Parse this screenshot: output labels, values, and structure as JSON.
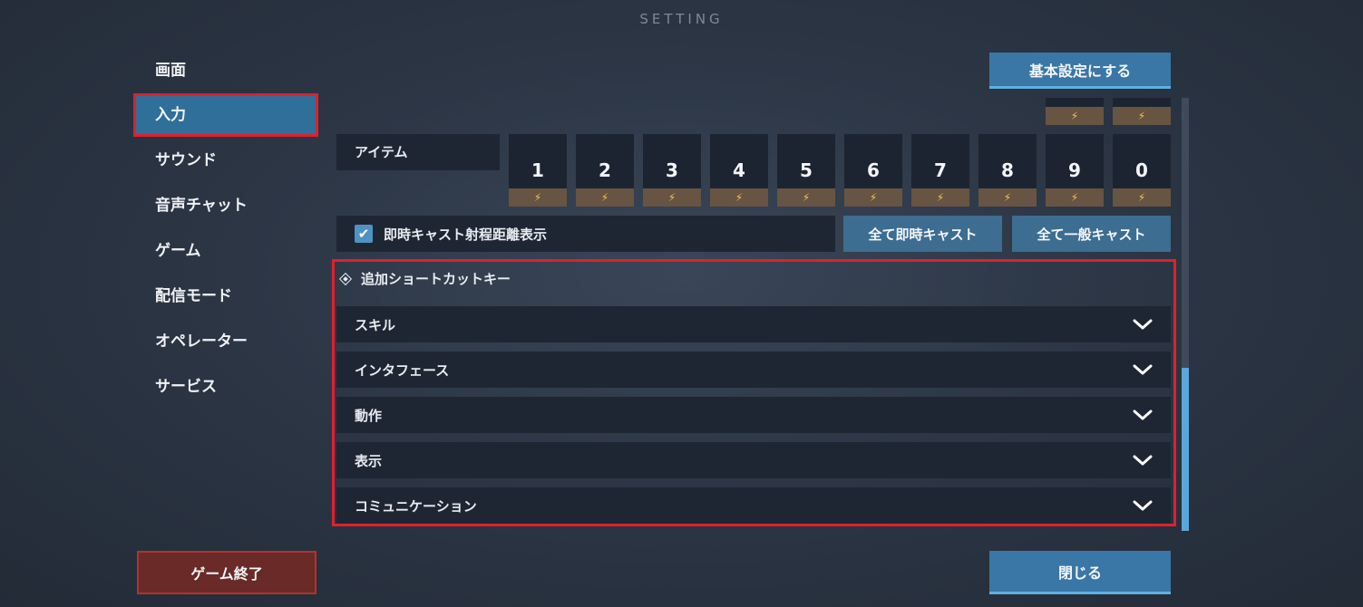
{
  "header": {
    "title": "SETTING"
  },
  "sidebar": {
    "items": [
      {
        "label": "画面"
      },
      {
        "label": "入力"
      },
      {
        "label": "サウンド"
      },
      {
        "label": "音声チャット"
      },
      {
        "label": "ゲーム"
      },
      {
        "label": "配信モード"
      },
      {
        "label": "オペレーター"
      },
      {
        "label": "サービス"
      }
    ],
    "active": "入力"
  },
  "toolbar": {
    "reset_label": "基本設定にする"
  },
  "items_row": {
    "label": "アイテム",
    "keys": [
      "1",
      "2",
      "3",
      "4",
      "5",
      "6",
      "7",
      "8",
      "9",
      "0"
    ]
  },
  "instant_cast": {
    "checkbox_label": "即時キャスト射程距離表示",
    "checked": true,
    "all_instant_label": "全て即時キャスト",
    "all_normal_label": "全て一般キャスト"
  },
  "shortcuts": {
    "title": "追加ショートカットキー",
    "sections": [
      {
        "label": "スキル"
      },
      {
        "label": "インタフェース"
      },
      {
        "label": "動作"
      },
      {
        "label": "表示"
      },
      {
        "label": "コミュニケーション"
      }
    ]
  },
  "footer": {
    "exit_label": "ゲーム終了",
    "close_label": "閉じる"
  },
  "colors": {
    "accent": "#3a77a6",
    "highlight": "#e0202c",
    "bolt": "#f4c24b",
    "exit": "#6a2a28"
  }
}
